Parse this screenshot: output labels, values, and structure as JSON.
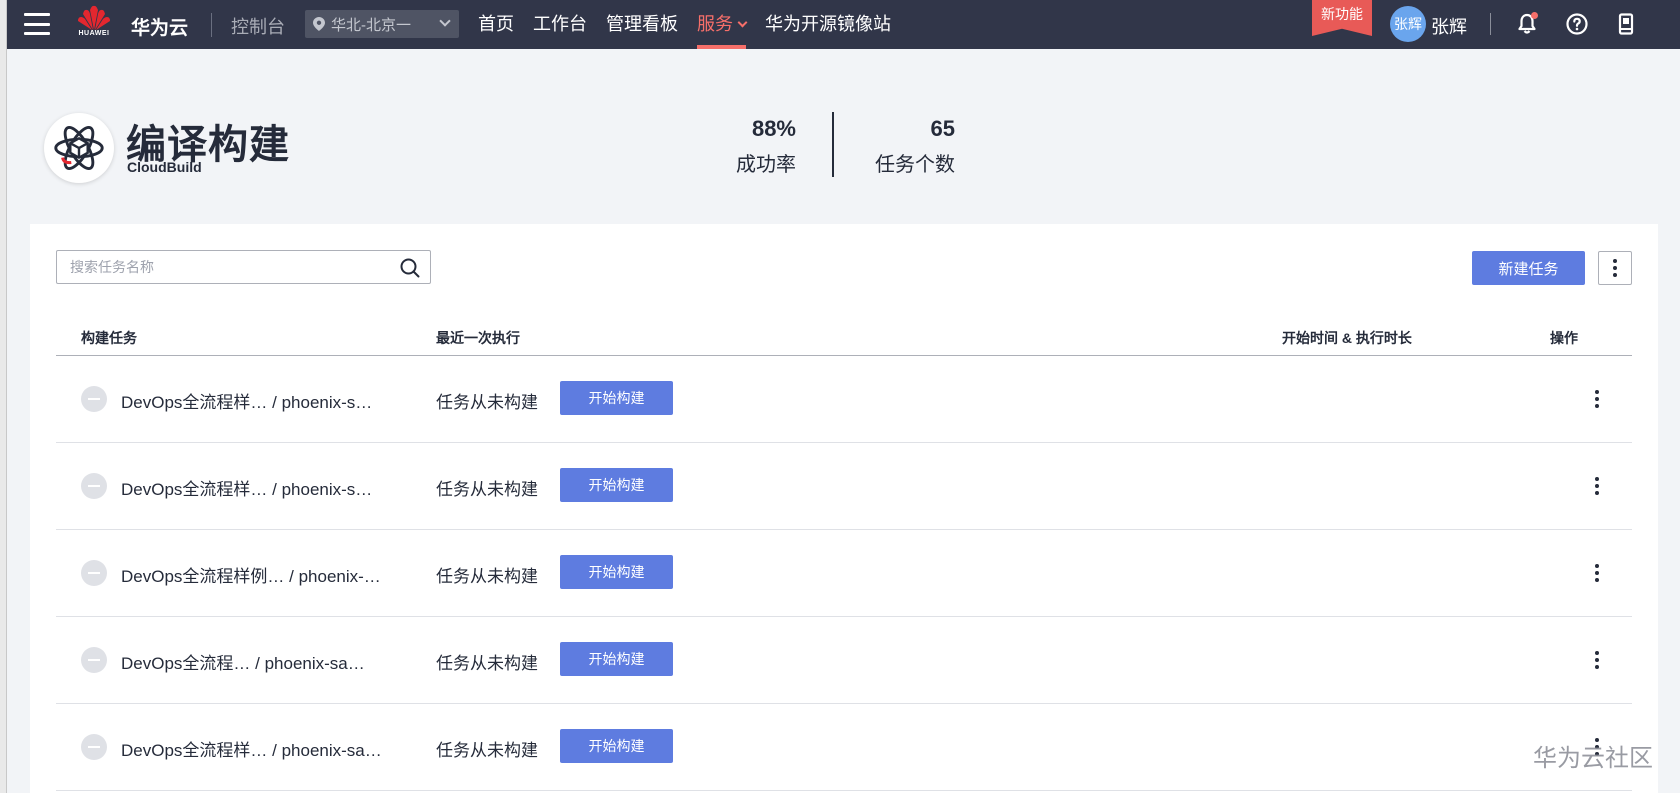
{
  "topbar": {
    "brand": "华为云",
    "logo_text": "HUAWEI",
    "console": "控制台",
    "region": "华北-北京一",
    "nav": [
      "首页",
      "工作台",
      "管理看板",
      "服务",
      "华为开源镜像站"
    ],
    "new_feature": "新功能",
    "avatar_text": "张辉",
    "username": "张辉",
    "colors": {
      "bar": "#313649",
      "active": "#f66f6a"
    }
  },
  "header": {
    "title": "编译构建",
    "subtitle": "CloudBuild",
    "stats": [
      {
        "value": "88%",
        "label": "成功率"
      },
      {
        "value": "65",
        "label": "任务个数"
      }
    ]
  },
  "toolbar": {
    "search_placeholder": "搜索任务名称",
    "new_task_label": "新建任务"
  },
  "table": {
    "columns": [
      "构建任务",
      "最近一次执行",
      "开始时间 & 执行时长",
      "操作"
    ],
    "start_label": "开始构建",
    "rows": [
      {
        "name": "DevOps全流程样…  / phoenix-s…",
        "last_run": "任务从未构建"
      },
      {
        "name": "DevOps全流程样…  / phoenix-s…",
        "last_run": "任务从未构建"
      },
      {
        "name": "DevOps全流程样例…  / phoenix-…",
        "last_run": "任务从未构建"
      },
      {
        "name": "DevOps全流程…    / phoenix-sa…",
        "last_run": "任务从未构建"
      },
      {
        "name": "DevOps全流程样…  / phoenix-sa…",
        "last_run": "任务从未构建"
      }
    ]
  },
  "watermark": "华为云社区",
  "accent": "#5e7ce0"
}
